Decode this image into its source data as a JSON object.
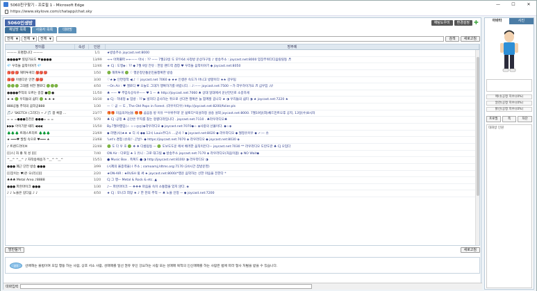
{
  "window": {
    "title": "5060친구찾기 - 프로필 1 - Microsoft Edge",
    "url": "https://www.skylove.com/chatapp/chat.sky",
    "min": "—",
    "max": "☐",
    "close": "✕"
  },
  "app": {
    "logo": "5060인생방",
    "tabs": [
      "채널방 목록",
      "사용자 목록",
      "대화방"
    ],
    "top_buttons": [
      "채팅도우미",
      "환경설정"
    ]
  },
  "filter": {
    "sel1": "전체",
    "sel2": "전체",
    "sel3": "전체",
    "search_btn": "검색",
    "refresh_btn": "새로고침"
  },
  "grid": {
    "headers": [
      "방이름",
      "속성",
      "인원",
      "방주제"
    ],
    "rows": [
      {
        "name": "——— 호명합니다 ———",
        "attr": "",
        "count": "1/1",
        "topic": "★방송주소 joycast.net:8000"
      },
      {
        "name": "●●●●♥ 힐링가요도 ♥●●●●",
        "attr": "",
        "count": "13/99",
        "topic": "→→ 아파뿔파 ←←ㅡㅡ 아시 : ?? ㅡㅡ 7월23일 도 모두64 사정방 운상하구둥 ♪ 방송주소 : joycast.net:8000 입장부위다디음릴릴둥 ♬"
      },
      {
        "name": "💎 우리들 음악이야기 💎",
        "attr": "",
        "count": "12/46",
        "topic": "★ CJ : 도멩◈ : ?? ◆ 7월 9일 전유 : 한봉 랜드력 겹칭 ♥ 우리들 음악이야기 ◆ joycast.net:8050"
      },
      {
        "name": "🎒🎒🎒 해피투게더 🎒🎒🎒",
        "attr": "",
        "count": "1/50",
        "topic": "🟢 해피투게 🟢 ♡ 행운정인통운민을행복한 방송"
      },
      {
        "name": "🎒🎒 아름다운 인연 🎒🎒",
        "attr": "",
        "count": "3/30",
        "topic": "♡★ ▶ 인연정착 ◀ ♪ ♡ joycast.net 7060 ◈ ★★ 인생은 속도가 아니고 방향이다 ★★ 감우팀"
      },
      {
        "name": "🟢🟢🟢 그대를 위한 멜로디 🟢🟢🟢",
        "attr": "",
        "count": "4/50",
        "topic": "ㅡOn Air : ♥ 엘로디 ♥ 오늘도 그대가 행복하기를 바랍니다. : ♪:ㅡㅡ joycast.net:7500 ㅡ가 라우하이가요 ♬ 심우입 :///"
      },
      {
        "name": "●●●●추억의 오르는 중잡 ●🟢●",
        "attr": "",
        "count": "11/50",
        "topic": "♣ ㅡㅡ ♥ 추입속상속우ㅡㅡ ♥ 1 ㅡ ♣ http://joycast.net:7060 ♣ 상대 일대에서 운난만인로 소중하게"
      },
      {
        "name": "★ ★ 🟢 우리들의 쉼터 🟢 ★ ★ ★",
        "attr": "",
        "count": "10/30",
        "topic": "◈ CJ : 히네정 ◈ 입방 : ?? ▶ 널허다 갑사하는 쥐으로 선다면 행복은 늘 함께할 겁니다 ★ ◑ 우리들의 쉼터 ◑ ★ joycast.net:7220 ★"
      },
      {
        "name": "888공통 추억의 음악공888",
        "attr": "",
        "count": "1/30",
        "topic": "ㅡ ♡ 곧 ㅡ 도 , The Old Pops in Forest. (라우이다우) http://joycast.net:8200/folier.pls"
      },
      {
        "name": "🎵♪ 'SKETCH (그리다) ~ ♪'🎵 팝 록팝 ...",
        "attr": "",
        "count": "23/77",
        "topic": "🎁🎁 미음의커님을 🎁🎁 곱음동 방 이유 **우위주테' 문 삶토다*의설하정 설송 설외 joycast.net:8000. 7월19일(화)채드민트오후 공지, 13일(수)8시자"
      },
      {
        "name": "= = =●●●중찬운 ●●●= = =",
        "attr": "",
        "count": "5/70",
        "topic": "♣ CJ :공정 ♣\n공안은 무지를 찾는 항결다라입니다 . joycast.net:7110 . ♣라우라디오♣"
      },
      {
        "name": "▶▶▶ 아이기분 때리 ◀◀◀",
        "attr": "",
        "count": "15/50",
        "topic": "By.7월아행입(☆ ☆☆◎◎)◈라우라디오 ◆ joycast.net:7070◆☆ ◈사랑의 선율이다. ◆☆◈"
      },
      {
        "name": "🌲🌲🌲 트래스트리트 🌲🌲🌲",
        "attr": "",
        "count": "23/69",
        "topic": "◆ 라명(사)★★ ★ 디 사 ◆◆ 12시 Louis주디스 ...군사 ? ◆ joycast.net:8020 ◆ 라우라디오 ◆ 뭘정유이우 ◆ ✓:ㅡ 슈"
      },
      {
        "name": "★ ━━━♥ 발질 속으로 ♥━━━ ★",
        "attr": "",
        "count": "23/68",
        "topic": "'Let's 경험 (슈의)'- 곤날!- ◆ https://joycast.net:7070 ◈ 라우라디오 ◆ joycast.net:8030 ◈"
      },
      {
        "name": "♪ 트렌드라이브",
        "attr": "",
        "count": "22/48",
        "topic": "🟢 도 다 우 호 🟢 ❖ ❖ 다름탐동 ㅡ 🟢 도보도도운 에서 배려한 움직이든다ㅡ joycast.net:7030 ** 라우라디오 도란도란 ♣ CJ 오입다"
      },
      {
        "name": "[[[스] 자 좋 적 성 ][[[",
        "attr": "",
        "count": "7/40",
        "topic": "ON Air : 다로임 ★ 1 유니 : 그로 대그릴 ◆ 방송주소 joycast.net:7170 ◈ 라우라디오(처음이옵) ◈ NO Wait◆"
      },
      {
        "name": "^‿^ ^‿^ ♪ 자작송에송가 ^‿^ ^‿^",
        "attr": "",
        "count": "15/51",
        "topic": "● Music Box . 축복드 ● ◑ http://joycast.net:8100/ ◑ 라우라디오 ◑"
      },
      {
        "name": "●●● 폐근 단언 방송 ●●●",
        "attr": "",
        "count": "3/99",
        "topic": "(시제의 울종력을) I 주소 ; comoamj;/dtms.org:7170 (24시간 잡방운영)"
      },
      {
        "name": "[[[장이는 ♥(은 오(리)]]]]",
        "attr": "",
        "count": "2/20",
        "topic": "★ON-AIR : ★RUSH 윗 써 ★ joycast.net:8000/*행운 음악하는 선한 마음을 전한다 *"
      },
      {
        "name": "♣♣♣ Metal Area ♪8888",
        "attr": "",
        "count": "1/20",
        "topic": "CJ 그 행ㅡ Metal & Rock & etc. ▲"
      },
      {
        "name": "●●● 파란마이크 ●●●",
        "attr": "",
        "count": "1/30",
        "topic": "♪ㅡ 파란마이크 ㅡ ❖❖❖ 마음을 속이 소통합을 있지 않다. ◈"
      },
      {
        "name": "♪ ♪ 노을은 길다움 ♪ ♪",
        "attr": "",
        "count": "4/50",
        "topic": "★ CJ : 모나크 희망 ★ ♪ 한 잔의 추억 ㅡ ♣ 노을 인정 ㅡ ◆ joycast.net:7200"
      }
    ]
  },
  "bottom": {
    "left_btn": "방만들기",
    "right_btn": "새로고침"
  },
  "notice": {
    "bubble": "공지",
    "text": "선배해는 불법이며 모임 행동 하는 사람, 상호 서소 사람, 성매매를 일선 권유 유인 강요하는 사람 또는 성매매 목적의 인신매매를 하는 사람은 법에 따라 형사 처벌을 받을 수 있습니다."
  },
  "input_label": "대화입력",
  "side": {
    "tabs": [
      "아바타",
      "사진"
    ],
    "stats": [
      "매너(공정 지수)(0%)",
      "알찬(공정 지수)(0%)",
      "밝신(공정 지수)(0%)"
    ],
    "buttons": [
      "프로필",
      "쪽",
      "차단"
    ],
    "conn_title": "대화방 인원"
  }
}
